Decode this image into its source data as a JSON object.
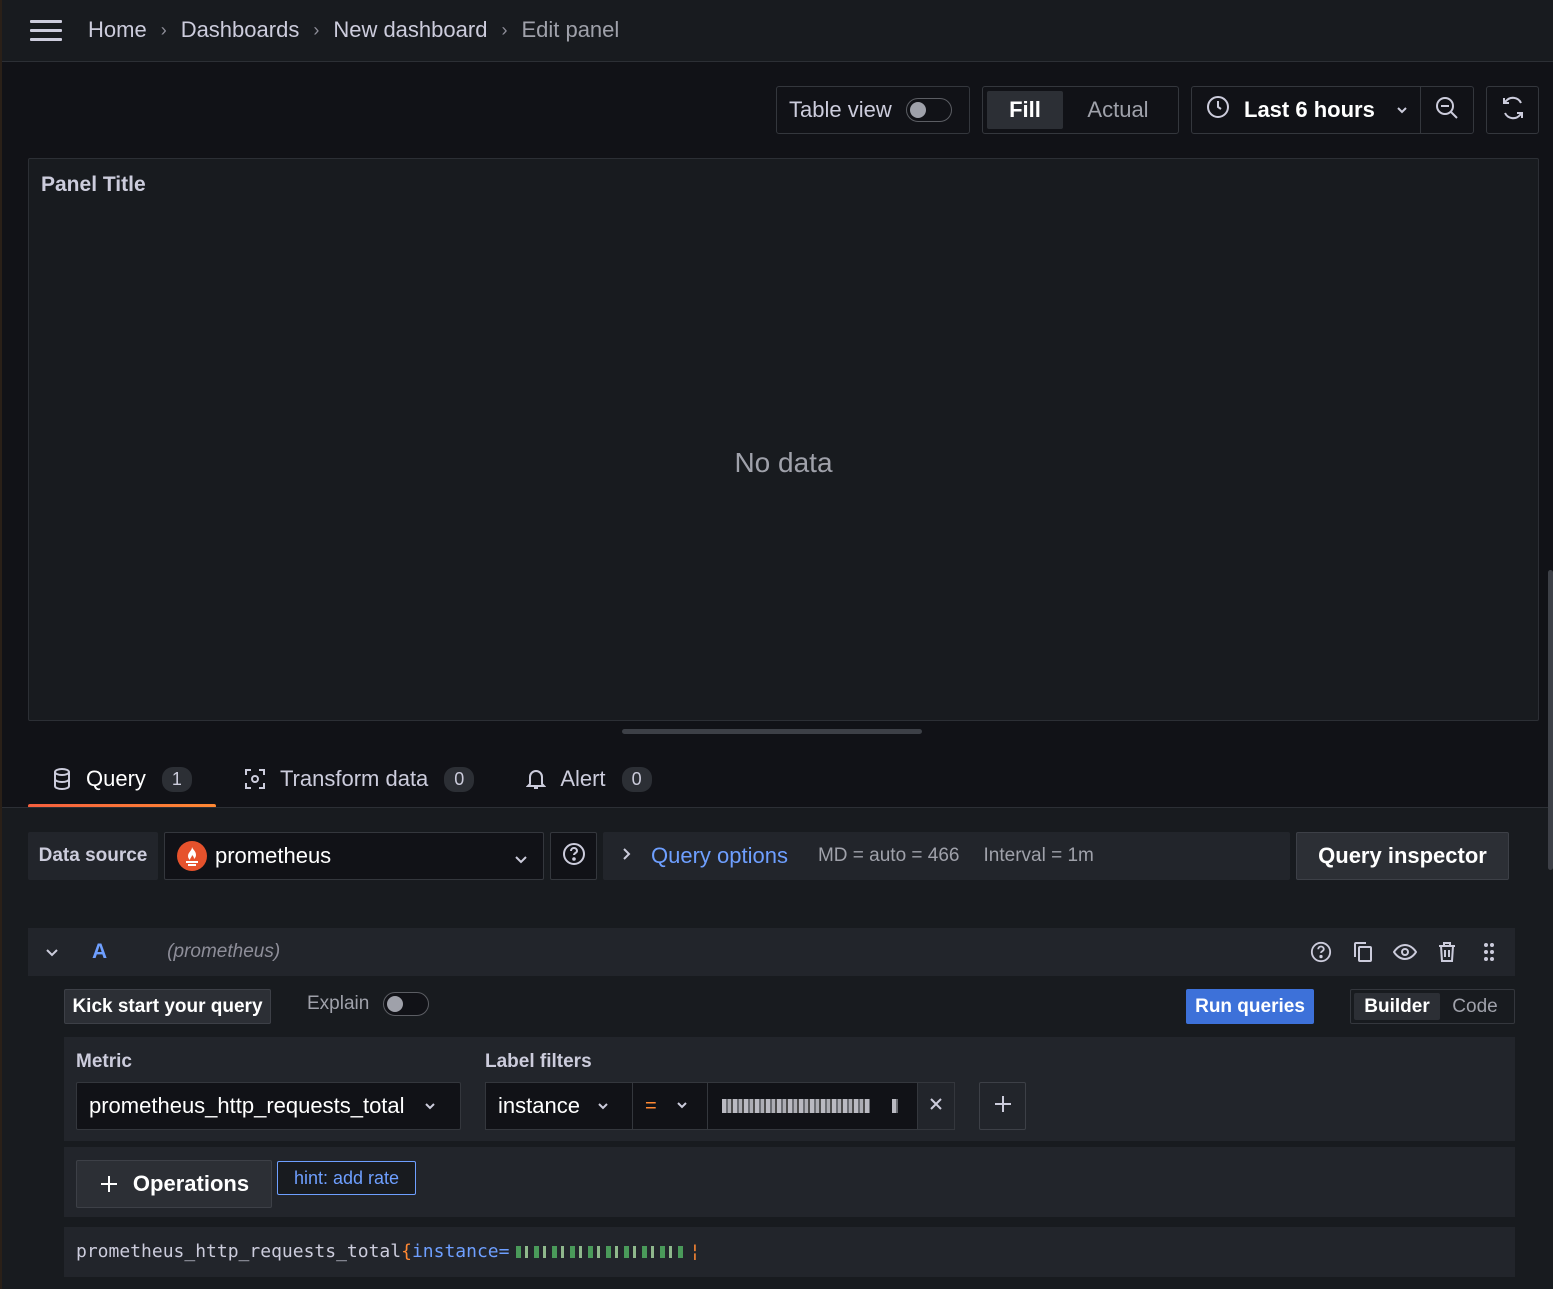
{
  "breadcrumb": {
    "items": [
      "Home",
      "Dashboards",
      "New dashboard"
    ],
    "current": "Edit panel"
  },
  "toolbar": {
    "table_view_label": "Table view",
    "table_view_on": false,
    "fill_label": "Fill",
    "actual_label": "Actual",
    "time_range": "Last 6 hours"
  },
  "panel": {
    "title": "Panel Title",
    "empty_message": "No data"
  },
  "tabs": [
    {
      "label": "Query",
      "count": "1",
      "icon": "database-icon",
      "active": true
    },
    {
      "label": "Transform data",
      "count": "0",
      "icon": "transform-icon",
      "active": false
    },
    {
      "label": "Alert",
      "count": "0",
      "icon": "bell-icon",
      "active": false
    }
  ],
  "datasource": {
    "label": "Data source",
    "selected": "prometheus",
    "query_options_label": "Query options",
    "md_info": "MD = auto = 466",
    "interval_info": "Interval = 1m",
    "inspector_label": "Query inspector"
  },
  "query_row": {
    "ref_id": "A",
    "datasource": "(prometheus)",
    "kickstart_label": "Kick start your query",
    "explain_label": "Explain",
    "explain_on": false,
    "run_label": "Run queries",
    "mode_builder": "Builder",
    "mode_code": "Code",
    "active_mode": "Builder"
  },
  "builder": {
    "metric_label": "Metric",
    "metric_value": "prometheus_http_requests_total",
    "label_filters_label": "Label filters",
    "filter_key": "instance",
    "filter_operator": "=",
    "operations_label": "Operations",
    "hint_label": "hint: add rate"
  },
  "preview": {
    "metric": "prometheus_http_requests_total",
    "open_brace": "{",
    "label_part": "instance="
  },
  "colors": {
    "accent_blue": "#6e9fff",
    "primary_button": "#3d71d9",
    "tab_underline": "#f55f3e",
    "operator": "#ff8833",
    "background": "#111217",
    "panel_bg": "#181b1f"
  }
}
